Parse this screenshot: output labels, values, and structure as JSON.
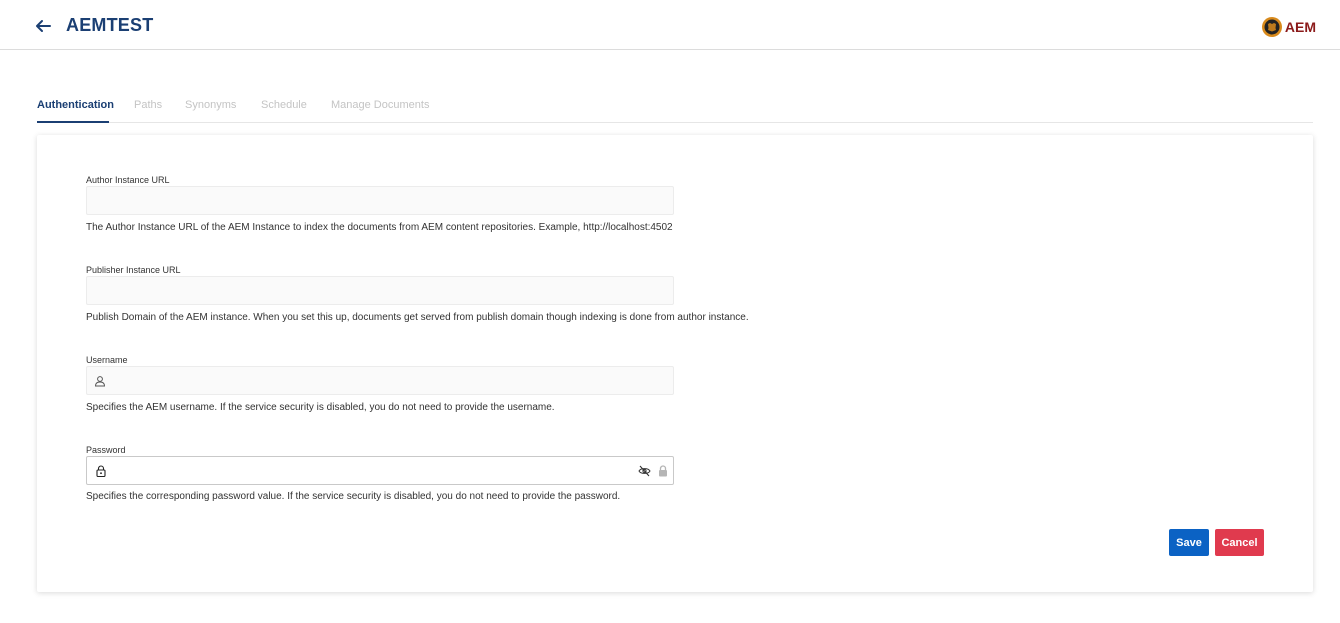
{
  "header": {
    "title": "AEMTEST",
    "brand_text": "AEM",
    "back_icon": "arrow-left-icon",
    "brand_icon": "aem-logo-icon"
  },
  "tabs": [
    {
      "label": "Authentication",
      "active": true
    },
    {
      "label": "Paths",
      "active": false
    },
    {
      "label": "Synonyms",
      "active": false
    },
    {
      "label": "Schedule",
      "active": false
    },
    {
      "label": "Manage Documents",
      "active": false
    }
  ],
  "form": {
    "author_url": {
      "label": "Author Instance URL",
      "value": "",
      "help": "The Author Instance URL of the AEM Instance to index the documents from AEM content repositories. Example, http://localhost:4502"
    },
    "publisher_url": {
      "label": "Publisher Instance URL",
      "value": "",
      "help": "Publish Domain of the AEM instance. When you set this up, documents get served from publish domain though indexing is done from author instance."
    },
    "username": {
      "label": "Username",
      "value": "",
      "icon": "user-icon",
      "help": "Specifies the AEM username. If the service security is disabled, you do not need to provide the username."
    },
    "password": {
      "label": "Password",
      "value": "",
      "icon": "lock-icon",
      "toggle_icon": "eye-slash-icon",
      "help": "Specifies the corresponding password value. If the service security is disabled, you do not need to provide the password."
    }
  },
  "actions": {
    "save_label": "Save",
    "cancel_label": "Cancel"
  },
  "colors": {
    "primary": "#1b3f73",
    "save": "#0b62c4",
    "cancel": "#e03a4e",
    "brand": "#8b1a1a"
  }
}
